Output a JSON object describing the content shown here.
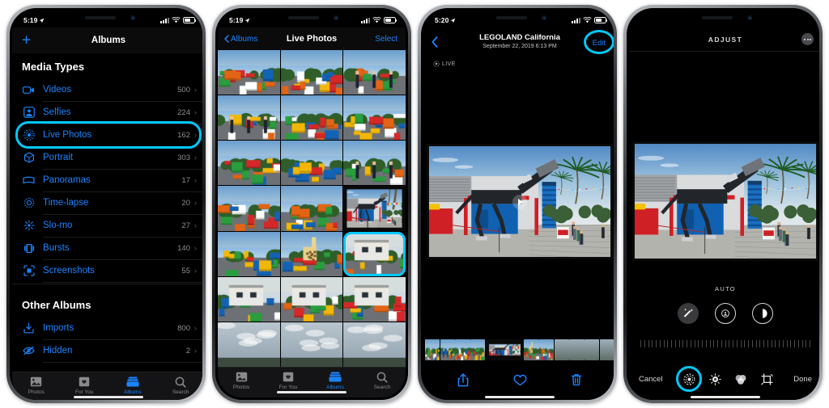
{
  "screens": [
    {
      "status": {
        "time": "5:19",
        "location_icon": "location-arrow-icon",
        "signal": "signal-bars-icon",
        "wifi": "wifi-icon",
        "battery": "battery-icon"
      },
      "nav": {
        "add_label": "+",
        "title": "Albums"
      },
      "sections": [
        {
          "heading": "Media Types",
          "rows": [
            {
              "icon": "video-camera-icon",
              "label": "Videos",
              "count": "500",
              "highlighted": false
            },
            {
              "icon": "selfie-person-icon",
              "label": "Selfies",
              "count": "224",
              "highlighted": false
            },
            {
              "icon": "live-photo-icon",
              "label": "Live Photos",
              "count": "162",
              "highlighted": true
            },
            {
              "icon": "portrait-cube-icon",
              "label": "Portrait",
              "count": "303",
              "highlighted": false
            },
            {
              "icon": "panorama-icon",
              "label": "Panoramas",
              "count": "17",
              "highlighted": false
            },
            {
              "icon": "timelapse-icon",
              "label": "Time-lapse",
              "count": "20",
              "highlighted": false
            },
            {
              "icon": "slomo-icon",
              "label": "Slo-mo",
              "count": "27",
              "highlighted": false
            },
            {
              "icon": "bursts-icon",
              "label": "Bursts",
              "count": "140",
              "highlighted": false
            },
            {
              "icon": "screenshots-icon",
              "label": "Screenshots",
              "count": "55",
              "highlighted": false
            }
          ]
        },
        {
          "heading": "Other Albums",
          "rows": [
            {
              "icon": "imports-icon",
              "label": "Imports",
              "count": "800",
              "highlighted": false
            },
            {
              "icon": "hidden-eye-icon",
              "label": "Hidden",
              "count": "2",
              "highlighted": false
            }
          ]
        }
      ],
      "tabs": [
        {
          "icon": "photos-icon",
          "label": "Photos",
          "active": false
        },
        {
          "icon": "for-you-icon",
          "label": "For You",
          "active": false
        },
        {
          "icon": "albums-icon",
          "label": "Albums",
          "active": true
        },
        {
          "icon": "search-icon",
          "label": "Search",
          "active": false
        }
      ]
    },
    {
      "status": {
        "time": "5:19"
      },
      "nav": {
        "back_label": "Albums",
        "title": "Live Photos",
        "select_label": "Select"
      },
      "grid": {
        "columns": 3,
        "selected_index": 14
      },
      "tabs": [
        {
          "icon": "photos-icon",
          "label": "Photos",
          "active": false
        },
        {
          "icon": "for-you-icon",
          "label": "For You",
          "active": false
        },
        {
          "icon": "albums-icon",
          "label": "Albums",
          "active": true
        },
        {
          "icon": "search-icon",
          "label": "Search",
          "active": false
        }
      ]
    },
    {
      "status": {
        "time": "5:20"
      },
      "nav": {
        "back_icon": "chevron-left-icon",
        "title": "LEGOLAND California",
        "subtitle": "September 22, 2019  6:13 PM",
        "edit_label": "Edit",
        "edit_highlighted": true
      },
      "live_badge": "LIVE",
      "toolbar": [
        {
          "icon": "share-icon",
          "label": "Share"
        },
        {
          "icon": "heart-icon",
          "label": "Favorite"
        },
        {
          "icon": "trash-icon",
          "label": "Delete"
        }
      ]
    },
    {
      "status": {
        "time": ""
      },
      "nav": {
        "title": "ADJUST",
        "more_icon": "more-dots-icon"
      },
      "auto_label": "AUTO",
      "modes": [
        {
          "icon": "magic-wand-icon",
          "selected": true
        },
        {
          "icon": "live-key-photo-icon",
          "selected": false
        },
        {
          "icon": "portrait-lighting-icon",
          "selected": false
        }
      ],
      "toolbar": {
        "cancel_label": "Cancel",
        "done_label": "Done",
        "tools": [
          {
            "icon": "live-photo-icon",
            "highlighted": true
          },
          {
            "icon": "adjust-dial-icon",
            "highlighted": false
          },
          {
            "icon": "filters-icon",
            "highlighted": false
          },
          {
            "icon": "crop-icon",
            "highlighted": false
          }
        ]
      }
    }
  ],
  "colors": {
    "accent_blue": "#1b84ff",
    "highlight_cyan": "#00c8fb",
    "background": "#000000",
    "secondary_text": "#8e8e93"
  }
}
